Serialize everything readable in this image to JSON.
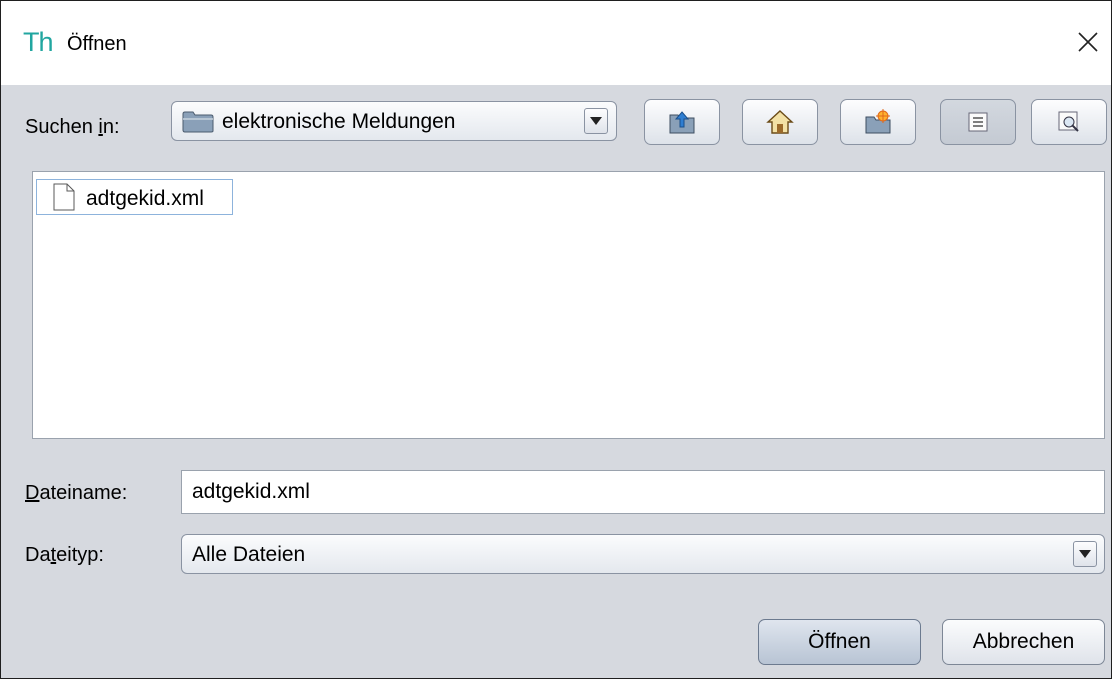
{
  "window": {
    "app_logo": "Th",
    "title": "Öffnen"
  },
  "lookin": {
    "label_pre": "Suchen ",
    "label_mn": "i",
    "label_post": "n:",
    "value": "elektronische Meldungen"
  },
  "toolbar": {
    "icons": [
      "up-folder-icon",
      "home-icon",
      "new-folder-icon",
      "list-view-icon",
      "details-view-icon"
    ],
    "active": "list-view"
  },
  "files": [
    {
      "name": "adtgekid.xml",
      "icon": "file-icon",
      "selected": true
    }
  ],
  "filename": {
    "label_mn": "D",
    "label_post": "ateiname:",
    "value": "adtgekid.xml"
  },
  "filetype": {
    "label_pre": "Da",
    "label_mn": "t",
    "label_post": "eityp:",
    "value": "Alle Dateien"
  },
  "buttons": {
    "open": "Öffnen",
    "cancel": "Abbrechen"
  },
  "colors": {
    "accent_logo": "#21a6a0",
    "background": "#d6d9df",
    "selection_border": "#8db3dc"
  }
}
